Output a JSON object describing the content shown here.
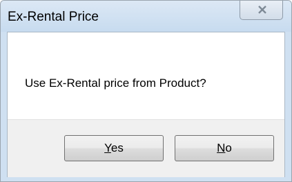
{
  "window": {
    "title": "Ex-Rental Price"
  },
  "message": "Use Ex-Rental price from Product?",
  "buttons": {
    "yes": {
      "mnemonic": "Y",
      "rest": "es"
    },
    "no": {
      "mnemonic": "N",
      "rest": "o"
    }
  },
  "icons": {
    "close": "close-icon"
  },
  "colors": {
    "titlebar": "#c7dbef",
    "button_area": "#f0f0f0"
  }
}
